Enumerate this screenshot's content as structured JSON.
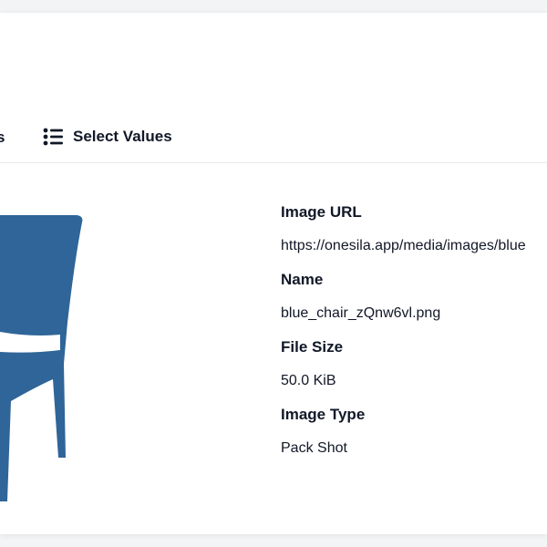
{
  "tabs": {
    "previous_label_fragment": "s",
    "select_values_label": "Select Values",
    "select_values_icon": "list-icon"
  },
  "preview": {
    "icon": "chair-image",
    "color": "#2f6598"
  },
  "image_info": {
    "fields": [
      {
        "label": "Image URL",
        "value": "https://onesila.app/media/images/blue"
      },
      {
        "label": "Name",
        "value": "blue_chair_zQnw6vl.png"
      },
      {
        "label": "File Size",
        "value": "50.0 KiB"
      },
      {
        "label": "Image Type",
        "value": "Pack Shot"
      }
    ]
  }
}
